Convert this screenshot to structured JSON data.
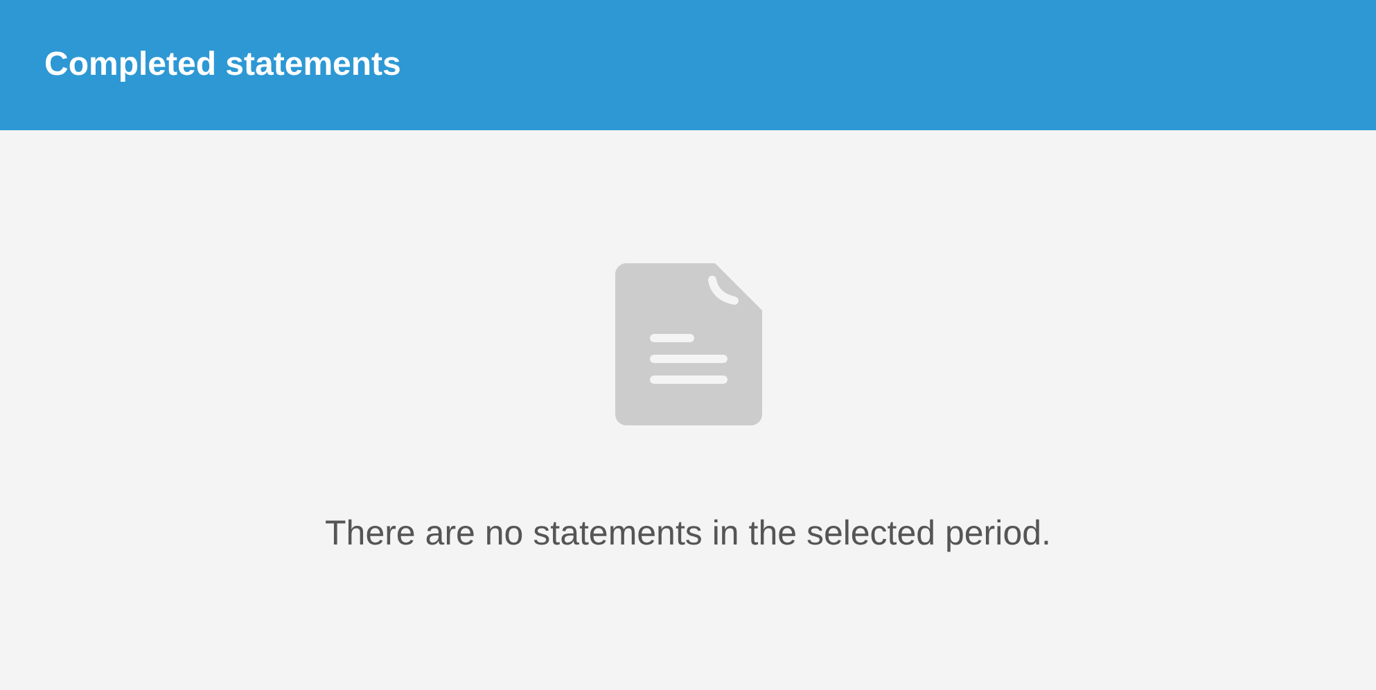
{
  "header": {
    "title": "Completed statements"
  },
  "empty_state": {
    "message": "There are no statements in the selected period."
  }
}
